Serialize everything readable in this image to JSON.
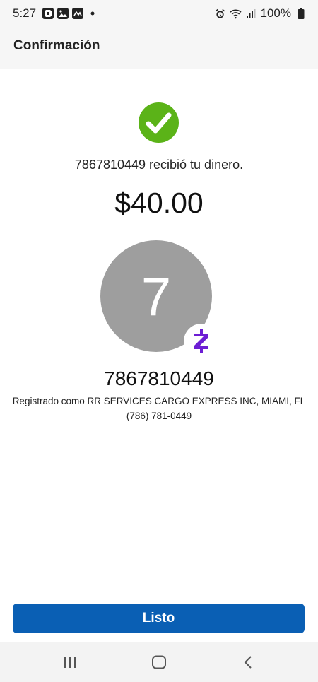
{
  "status": {
    "time": "5:27",
    "battery_text": "100%",
    "icons_left": [
      "chase-app-icon",
      "gallery-icon",
      "mail-icon",
      "dot-icon"
    ],
    "icons_right": [
      "alarm-icon",
      "wifi-icon",
      "signal-icon",
      "battery-icon"
    ]
  },
  "appbar": {
    "title": "Confirmación"
  },
  "confirmation": {
    "icon": "check-circle-icon",
    "icon_color": "#5bb318",
    "message": "7867810449 recibió tu dinero.",
    "amount": "$40.00"
  },
  "recipient": {
    "avatar_initial": "7",
    "avatar_color": "#9e9e9e",
    "badge_icon": "zelle-icon",
    "badge_color": "#6d1ed4",
    "name": "7867810449",
    "registered_as": "Registrado como RR SERVICES CARGO EXPRESS INC, MIAMI, FL",
    "phone": "(786) 781-0449"
  },
  "actions": {
    "done_label": "Listo",
    "done_color": "#0a5fb4"
  },
  "navbar": {
    "items": [
      "recent-apps-icon",
      "home-icon",
      "back-icon"
    ]
  }
}
